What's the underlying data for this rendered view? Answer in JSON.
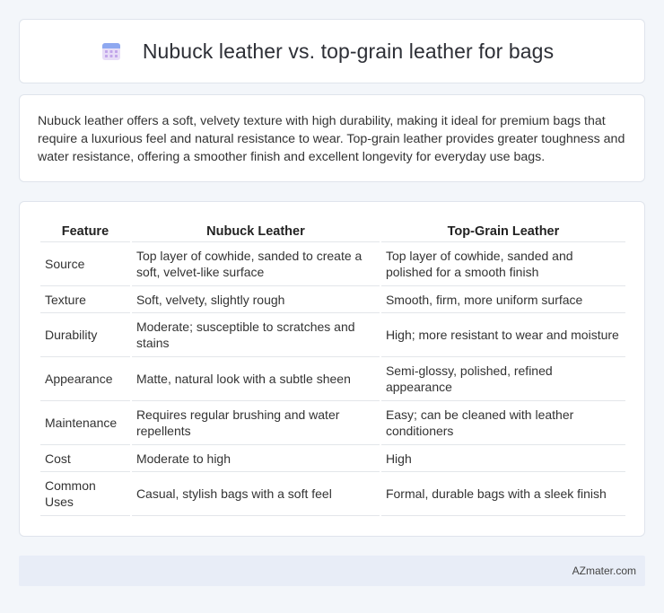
{
  "header": {
    "title": "Nubuck leather vs. top-grain leather for bags",
    "icon": "calendar-icon"
  },
  "summary": {
    "text": "Nubuck leather offers a soft, velvety texture with high durability, making it ideal for premium bags that require a luxurious feel and natural resistance to wear. Top-grain leather provides greater toughness and water resistance, offering a smoother finish and excellent longevity for everyday use bags."
  },
  "table": {
    "headers": [
      "Feature",
      "Nubuck Leather",
      "Top-Grain Leather"
    ],
    "rows": [
      [
        "Source",
        "Top layer of cowhide, sanded to create a soft, velvet-like surface",
        "Top layer of cowhide, sanded and polished for a smooth finish"
      ],
      [
        "Texture",
        "Soft, velvety, slightly rough",
        "Smooth, firm, more uniform surface"
      ],
      [
        "Durability",
        "Moderate; susceptible to scratches and stains",
        "High; more resistant to wear and moisture"
      ],
      [
        "Appearance",
        "Matte, natural look with a subtle sheen",
        "Semi-glossy, polished, refined appearance"
      ],
      [
        "Maintenance",
        "Requires regular brushing and water repellents",
        "Easy; can be cleaned with leather conditioners"
      ],
      [
        "Cost",
        "Moderate to high",
        "High"
      ],
      [
        "Common Uses",
        "Casual, stylish bags with a soft feel",
        "Formal, durable bags with a sleek finish"
      ]
    ]
  },
  "footer": {
    "brand": "AZmater.com"
  }
}
